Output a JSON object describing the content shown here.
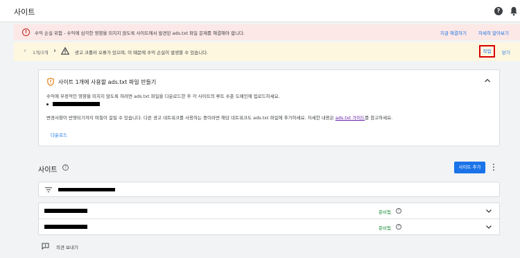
{
  "header": {
    "title": "사이트"
  },
  "alert_red": {
    "message": "수익 손실 위험 - 수익에 심각한 영향을 미치지 않도록 사이트에서 발견된 ads.txt 파일 문제를 해결해야 합니다.",
    "fix_now": "지금 해결하기",
    "learn_more": "자세히 알아보기"
  },
  "alert_yellow": {
    "pager": "1개/3개",
    "message": "광고 크롤러 오류가 있으며, 이 때문에 수익 손실이 발생할 수 있습니다.",
    "action": "작업",
    "close": "닫기"
  },
  "ads_card": {
    "title": "사이트 1개에 사용할 ads.txt 파일 만들기",
    "body1": "수익에 부정적인 영향을 미치지 않도록 하려면 ads.txt 파일을 다운로드한 후 각 사이트의 루트 수준 도메인에 업로드하세요.",
    "body2_a": "변경사항이 반영되기까지 며칠이 걸릴 수 있습니다. 다른 광고 네트워크를 사용하는 중이라면 해당 네트워크도 ads.txt 파일에 추가하세요. 자세한 내용은 ",
    "body2_link": "ads.txt 가이드",
    "body2_b": "를 참고하세요.",
    "download": "다운로드"
  },
  "sites": {
    "title": "사이트",
    "add_site": "사이트 추가",
    "rows": [
      {
        "status": "준비됨"
      },
      {
        "status": "준비됨"
      }
    ]
  },
  "footer": {
    "feedback": "의견 보내기"
  },
  "colors": {
    "accent": "#1a73e8",
    "error": "#c5221f",
    "ready": "#1e8e3e",
    "highlight_border": "#d50000"
  },
  "icons": [
    "help-icon",
    "bell-icon",
    "error-icon",
    "warning-icon",
    "shield-icon",
    "chevron-up-icon",
    "filter-icon",
    "chevron-down-icon",
    "info-icon",
    "feedback-icon",
    "more-vert-icon"
  ]
}
